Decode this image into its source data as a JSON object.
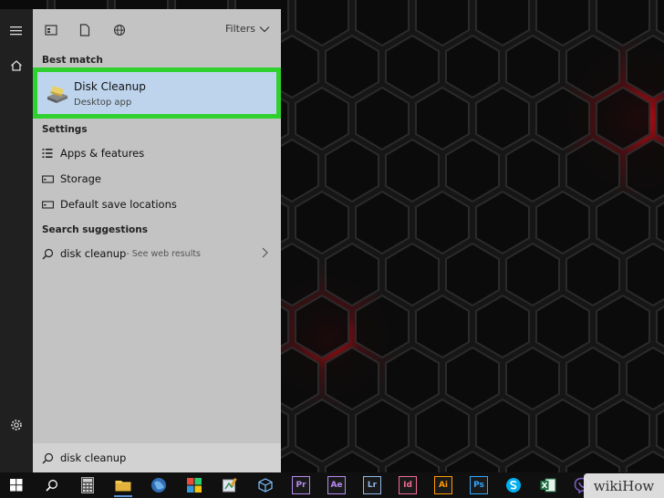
{
  "panel": {
    "filters_label": "Filters",
    "best_match_heading": "Best match",
    "best_match": {
      "title": "Disk Cleanup",
      "subtitle": "Desktop app"
    },
    "settings_heading": "Settings",
    "settings_items": [
      {
        "label": "Apps & features",
        "icon": "list-icon"
      },
      {
        "label": "Storage",
        "icon": "storage-icon"
      },
      {
        "label": "Default save locations",
        "icon": "storage-icon"
      }
    ],
    "suggestions_heading": "Search suggestions",
    "suggestion": {
      "query": "disk cleanup",
      "suffix": " - See web results"
    },
    "search_value": "disk cleanup"
  },
  "taskbar": {
    "apps": [
      {
        "name": "Premiere Pro",
        "text": "Pr",
        "color": "#b68bf0"
      },
      {
        "name": "After Effects",
        "text": "Ae",
        "color": "#b68bf0"
      },
      {
        "name": "Lightroom",
        "text": "Lr",
        "color": "#8fb8e8"
      },
      {
        "name": "InDesign",
        "text": "Id",
        "color": "#f06a93"
      },
      {
        "name": "Illustrator",
        "text": "Ai",
        "color": "#ff9a00"
      },
      {
        "name": "Photoshop",
        "text": "Ps",
        "color": "#31a8ff"
      }
    ]
  },
  "watermark": "wikiHow",
  "colors": {
    "highlight_border": "#2fd12f",
    "selected_bg": "#bdd4ec",
    "panel_bg": "#c3c3c3"
  }
}
